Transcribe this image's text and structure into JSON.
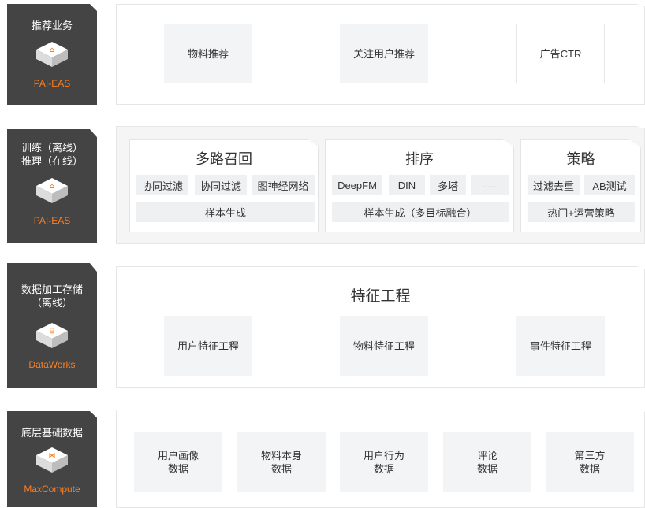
{
  "layers": [
    {
      "side_title": "推荐业务",
      "side_brand": "PAI-EAS",
      "items": [
        "物料推荐",
        "关注用户推荐",
        "广告CTR"
      ]
    },
    {
      "side_title": "训练（离线）\n推理（在线）",
      "side_brand": "PAI-EAS",
      "cards": [
        {
          "title": "多路召回",
          "chips": [
            "协同过滤",
            "协同过滤",
            "图神经网络"
          ],
          "footer": "样本生成"
        },
        {
          "title": "排序",
          "chips": [
            "DeepFM",
            "DIN",
            "多塔",
            "......"
          ],
          "footer": "样本生成（多目标融合）"
        },
        {
          "title": "策略",
          "chips": [
            "过滤去重",
            "AB测试"
          ],
          "footer": "热门+运营策略"
        }
      ]
    },
    {
      "side_title": "数据加工存储\n（离线）",
      "side_brand": "DataWorks",
      "title": "特征工程",
      "items": [
        "用户特征工程",
        "物料特征工程",
        "事件特征工程"
      ]
    },
    {
      "side_title": "底层基础数据",
      "side_brand": "MaxCompute",
      "items": [
        "用户画像\n数据",
        "物料本身\n数据",
        "用户行为\n数据",
        "评论\n数据",
        "第三方\n数据"
      ]
    }
  ],
  "icons": {
    "pai_eas": "pai-eas-cube-icon",
    "dataworks": "dataworks-cube-icon",
    "maxcompute": "maxcompute-cube-icon"
  },
  "colors": {
    "side_bg": "#444444",
    "brand": "#ff7f1e",
    "box_bg": "#f2f4f5"
  }
}
